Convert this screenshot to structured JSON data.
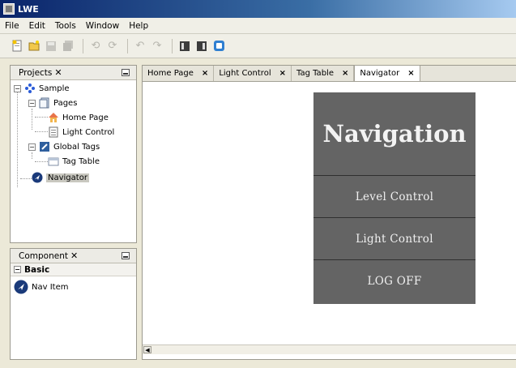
{
  "window": {
    "title": "LWE"
  },
  "menu": [
    "File",
    "Edit",
    "Tools",
    "Window",
    "Help"
  ],
  "projects_panel": {
    "title": "Projects",
    "close": "✕",
    "tree": {
      "root": "Sample",
      "pages": "Pages",
      "home_page": "Home Page",
      "light_control": "Light Control",
      "global_tags": "Global Tags",
      "tag_table": "Tag Table",
      "navigator": "Navigator"
    }
  },
  "component_panel": {
    "title": "Component",
    "close": "✕",
    "category": "Basic",
    "item": "Nav Item"
  },
  "tabs": [
    {
      "label": "Home Page",
      "close": "×"
    },
    {
      "label": "Light Control",
      "close": "×"
    },
    {
      "label": "Tag Table",
      "close": "×"
    },
    {
      "label": "Navigator",
      "close": "×"
    }
  ],
  "navigator_widget": {
    "title": "Navigation",
    "items": [
      "Level Control",
      "Light Control",
      "LOG OFF"
    ]
  },
  "colors": {
    "accent": "#0a246a",
    "nav_background": "#646464",
    "nav_text": "#f3f3f3"
  }
}
